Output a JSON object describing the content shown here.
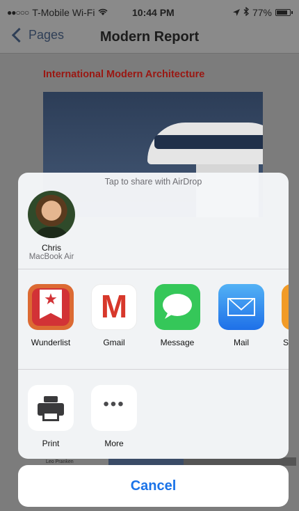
{
  "status_bar": {
    "signal": "●●○○○",
    "carrier": "T-Mobile Wi-Fi",
    "wifi_icon": "wifi-icon",
    "time": "10:44 PM",
    "location_icon": "location-arrow-icon",
    "bluetooth_icon": "bluetooth-icon",
    "battery_percent": "77%",
    "battery_level": 0.77
  },
  "nav_bar": {
    "back_label": "Pages",
    "title": "Modern Report"
  },
  "document": {
    "heading": "International Modern Architecture",
    "caption": "Leo Pranken"
  },
  "share_sheet": {
    "airdrop_hint": "Tap to share with AirDrop",
    "airdrop_person": {
      "name": "Chris",
      "device": "MacBook Air"
    },
    "apps": [
      {
        "label": "Wunderlist",
        "icon": "wunderlist-icon"
      },
      {
        "label": "Gmail",
        "icon": "gmail-icon",
        "glyph": "M"
      },
      {
        "label": "Message",
        "icon": "message-icon"
      },
      {
        "label": "Mail",
        "icon": "mail-icon"
      },
      {
        "label": "Sa",
        "icon": "safari-icon"
      }
    ],
    "actions": [
      {
        "label": "Print",
        "icon": "printer-icon"
      },
      {
        "label": "More",
        "icon": "more-icon",
        "glyph": "•••"
      }
    ]
  },
  "cancel_label": "Cancel",
  "colors": {
    "accent_blue": "#1a73e8",
    "heading_red": "#9a1712"
  }
}
